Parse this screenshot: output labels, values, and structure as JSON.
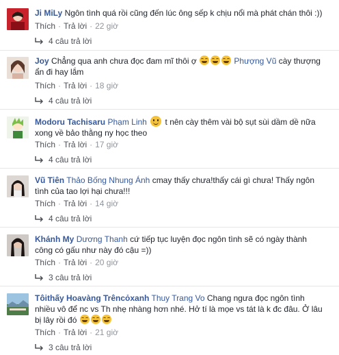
{
  "labels": {
    "like": "Thích",
    "reply": "Trả lời",
    "dot": "·"
  },
  "comments": [
    {
      "author": "Ji MiLy",
      "text": "Ngôn tình quá rồi cũng đến lúc ông sếp k chịu nổi mà phát chán thôi :))",
      "time": "22 giờ",
      "replies": "4 câu trả lời"
    },
    {
      "author": "Joy",
      "text1": "Chẳng qua anh chưa đọc đam mĩ thôi ợ",
      "mention": "Phượng Vũ",
      "text2": "cày thượng ẩn đi hay lắm",
      "time": "18 giờ",
      "replies": "4 câu trả lời"
    },
    {
      "author": "Modoru Tachisaru",
      "mention": "Phạm Linh",
      "text1": "t nên cày thêm vài bộ sụt sùi dầm dề nữa",
      "text2": "xong về bảo thằng ny học theo",
      "time": "17 giờ",
      "replies": "4 câu trả lời"
    },
    {
      "author": "Vũ Tiên",
      "mention": "Thảo Bống Nhung Ánh",
      "text1": "cmay thấy chưa!thấy cái gì chưa! Thấy ngôn",
      "text2": "tình của tao lợi hại chưa!!!",
      "time": "14 giờ",
      "replies": "4 câu trả lời"
    },
    {
      "author": "Khánh My",
      "mention": "Dương Thanh",
      "text1": "cứ tiếp tục luyện đọc ngôn tình sẽ có ngày thành",
      "text2": "công có gấu như này đó cậu =))",
      "time": "20 giờ",
      "replies": "3 câu trả lời"
    },
    {
      "author": "Tôithấy Hoavàng Trêncỏxanh",
      "mention": "Thuy Trang Vo",
      "text1": "Chang ngưa đọc ngôn tình",
      "text2": "nhiều vô để nc vs Th nhẹ nhàng hơn nhé. Hở tí là mọe vs tát là k đc đâu. Ở lâu",
      "text3": "bị lây rồi đó",
      "time": "21 giờ",
      "replies": "3 câu trả lời"
    }
  ],
  "colors": {
    "link": "#365899",
    "meta": "#90949c",
    "action": "#4b4f56",
    "divider": "#e5e6e9"
  }
}
